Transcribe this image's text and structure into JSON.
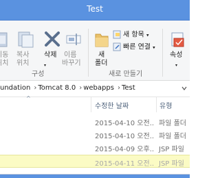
{
  "window": {
    "title": "Test"
  },
  "ribbon": {
    "partial_left_1": [
      "이동",
      "위치"
    ],
    "partial_left_2": [
      "복사",
      "위치"
    ],
    "delete_label": "삭제",
    "rename_label": [
      "이름",
      "바꾸기"
    ],
    "organize_group": "구성",
    "new_folder_label": [
      "새",
      "폴더"
    ],
    "new_item_label": "새 항목",
    "easy_access_label": "빠른 연결",
    "new_group": "새로 만들기",
    "properties_label": "속성"
  },
  "address": {
    "segments": [
      "undation",
      "Tomcat 8.0",
      "webapps",
      "Test"
    ]
  },
  "columns": {
    "date": "수정한 날짜",
    "type": "유형"
  },
  "files": [
    {
      "date": "2015-04-10 오전...",
      "type": "파일 폴더"
    },
    {
      "date": "2015-04-10 오전...",
      "type": "파일 폴더"
    },
    {
      "date": "2015-04-09 오후...",
      "type": "JSP 파일"
    },
    {
      "date": "2015-04-11 오전...",
      "type": "JSP 파일",
      "selected": true
    }
  ],
  "colors": {
    "titlebar": "#5a92e0",
    "selection": "#fbfbc4"
  }
}
